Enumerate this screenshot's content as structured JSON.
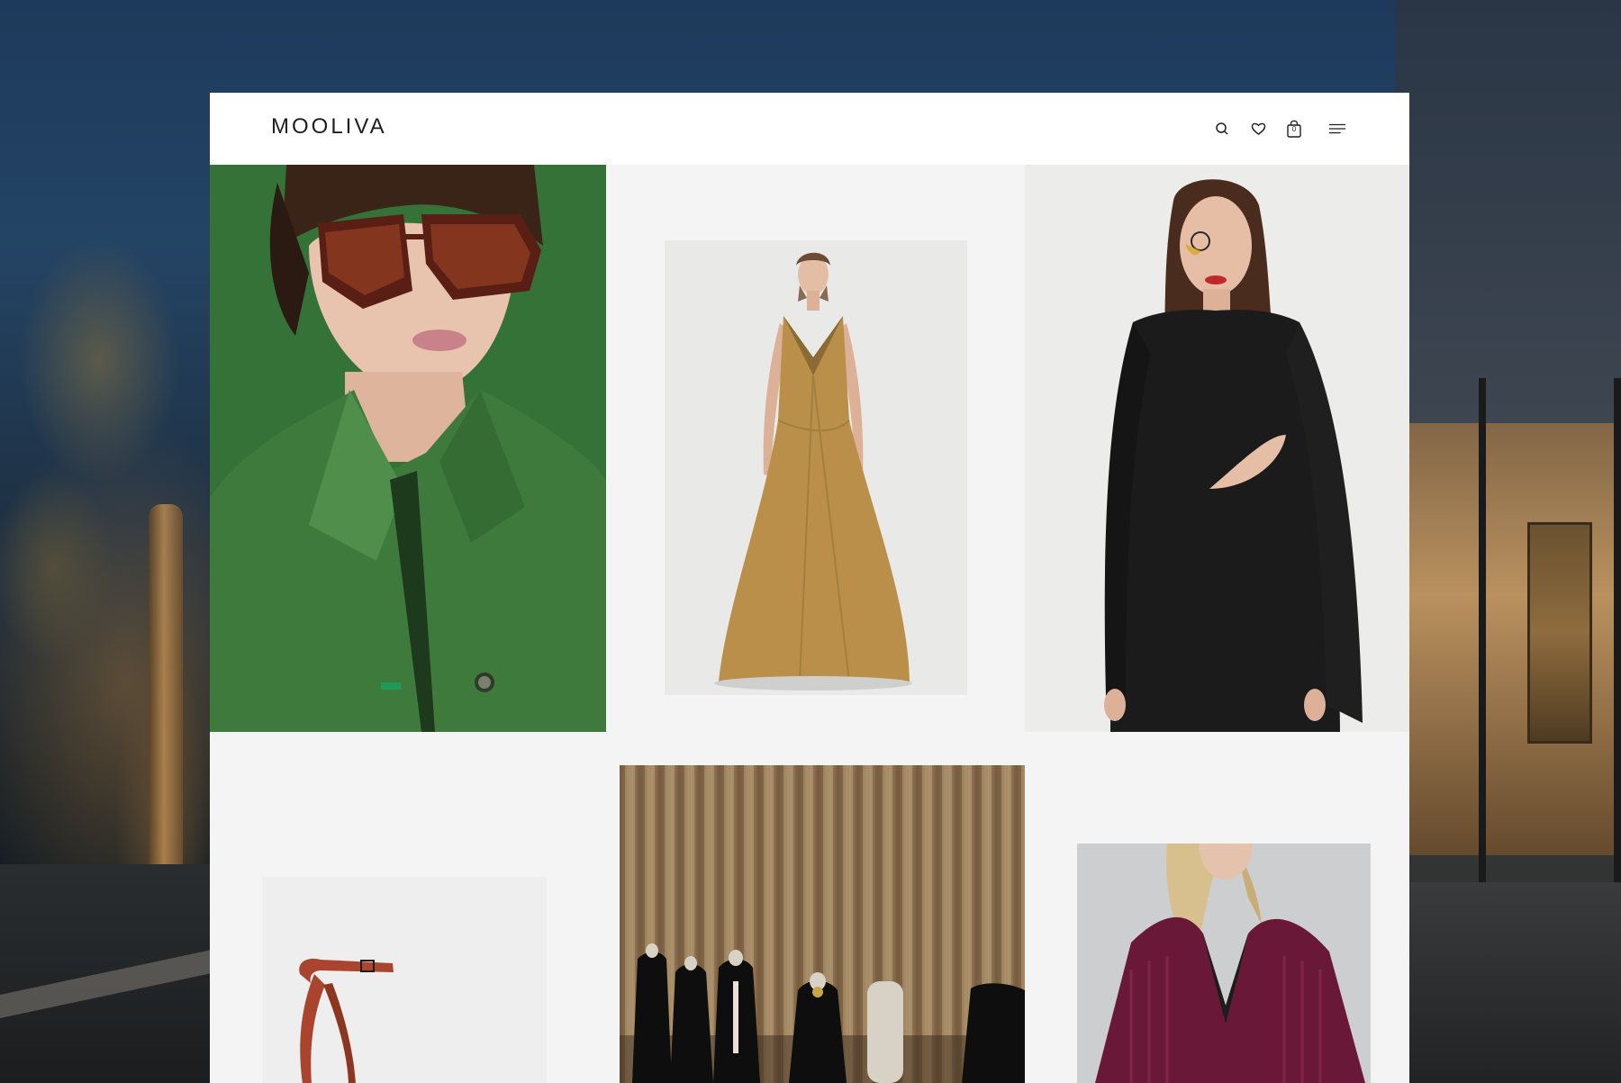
{
  "brand": {
    "logo_text": "MOOLIVA"
  },
  "header": {
    "icons": [
      "search-icon",
      "heart-icon",
      "bag-icon",
      "menu-icon"
    ],
    "cart_count": "0"
  },
  "colors": {
    "page_background": "#f4f4f4",
    "header_background": "#ffffff",
    "text": "#1e1e1e",
    "coat_green": "#3f7a3d",
    "gown_gold": "#b98f4a",
    "dress_black": "#1b1b1b",
    "sandal_red": "#a9442e",
    "cardigan_burgundy": "#6a1838",
    "curtain_tan": "#b9956a"
  },
  "gallery": {
    "items": [
      {
        "name": "green-coat-sunglasses-photo"
      },
      {
        "name": "gold-satin-gown-photo"
      },
      {
        "name": "black-cutout-dress-photo"
      },
      {
        "name": "red-strap-sandal-photo"
      },
      {
        "name": "boutique-curtain-mannequins-photo"
      },
      {
        "name": "burgundy-knit-cardigan-photo"
      }
    ]
  }
}
